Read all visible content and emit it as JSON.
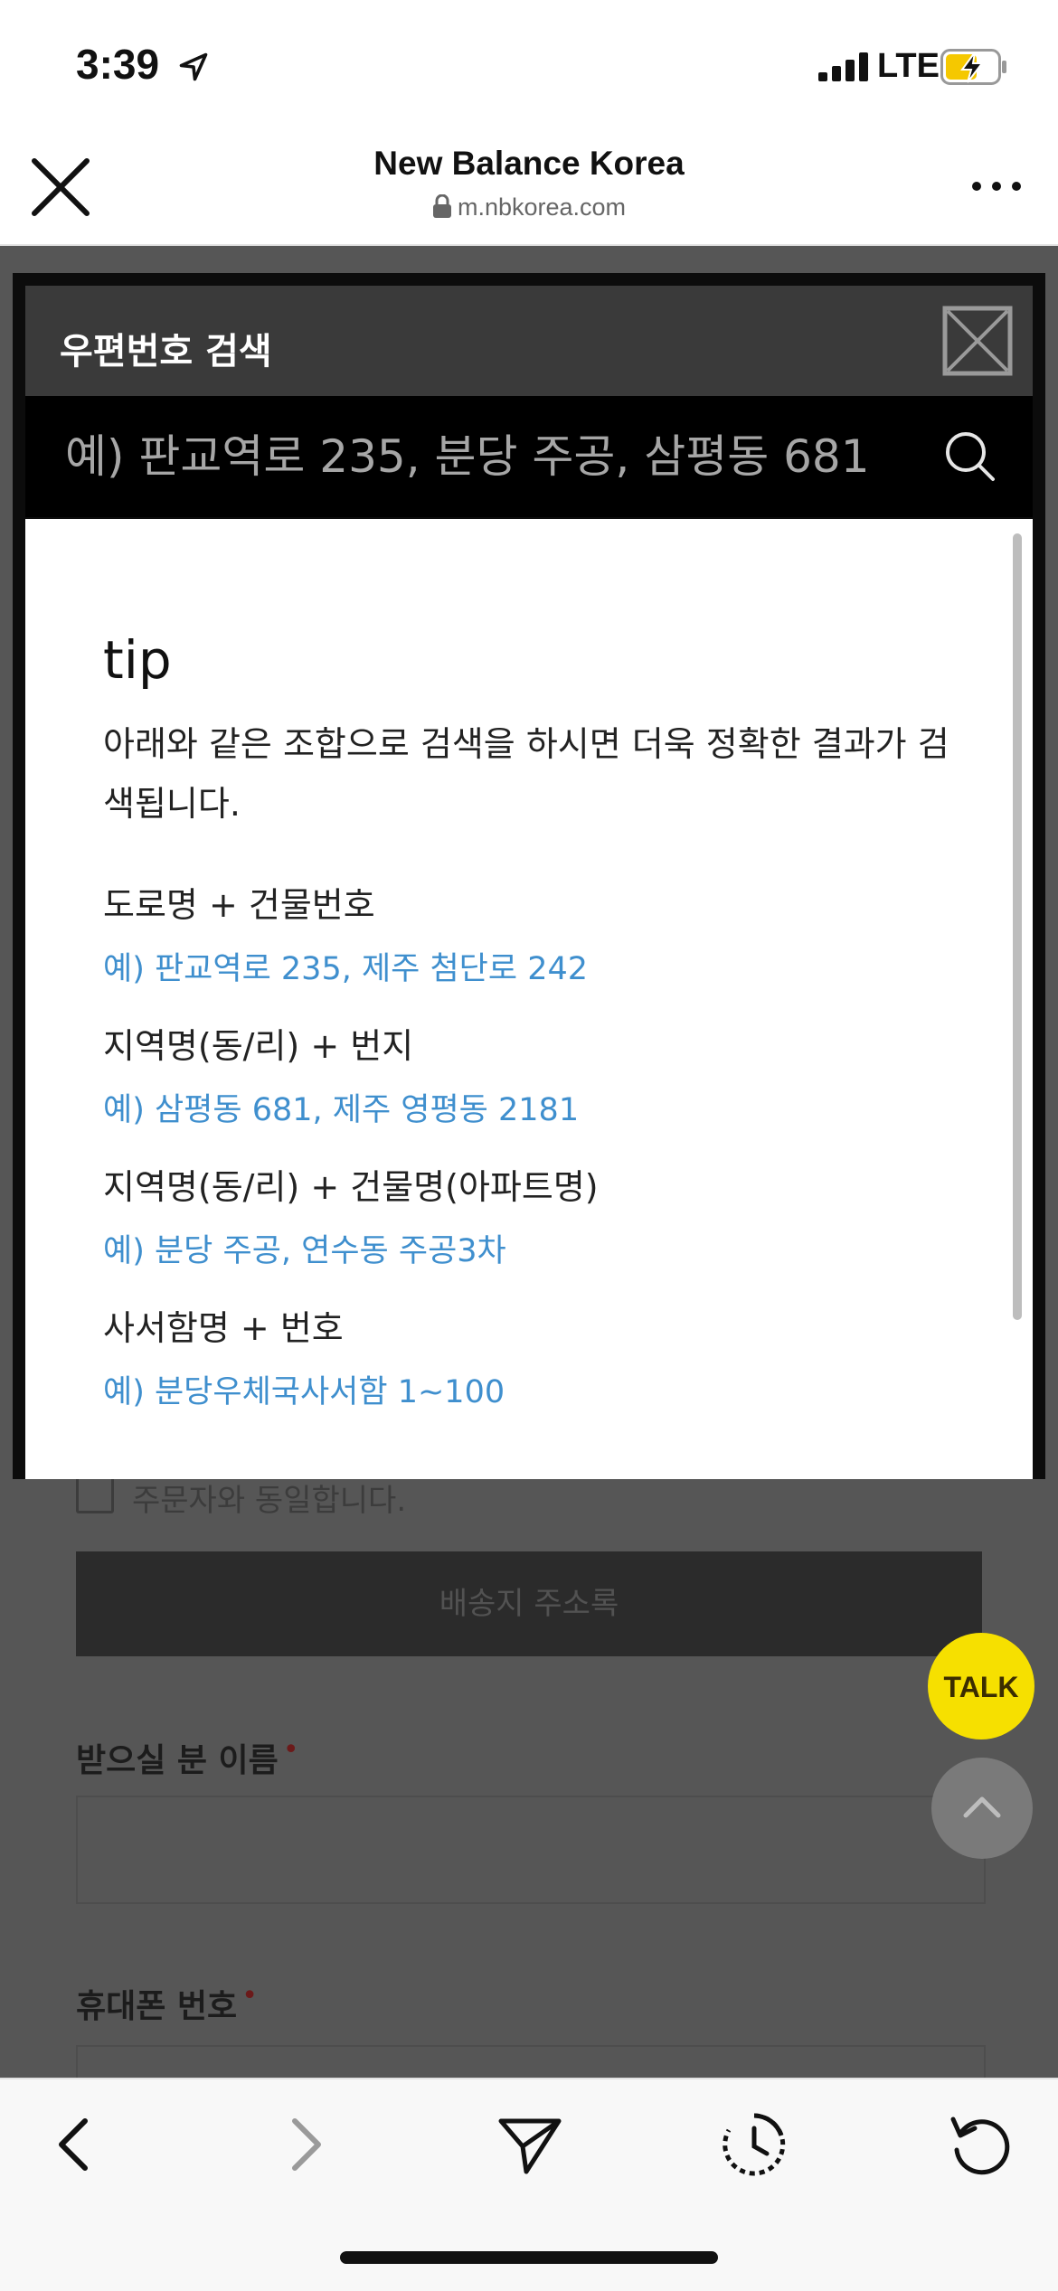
{
  "status_bar": {
    "time": "3:39",
    "network": "LTE"
  },
  "browser": {
    "title": "New Balance Korea",
    "url": "m.nbkorea.com"
  },
  "background_page": {
    "same_as_orderer_label": "주문자와 동일합니다.",
    "address_book_button": "배송지 주소록",
    "recipient_name_label": "받으실 분 이름",
    "phone_label": "휴대폰 번호",
    "required_mark": "•",
    "talk_button": "TALK"
  },
  "modal": {
    "title": "우편번호 검색",
    "search_placeholder": "예) 판교역로 235, 분당 주공, 삼평동 681",
    "tip_title": "tip",
    "tip_description": "아래와 같은 조합으로 검색을 하시면 더욱 정확한 결과가 검색됩니다.",
    "categories": [
      {
        "label": "도로명 + 건물번호",
        "example": "예) 판교역로 235,  제주 첨단로 242"
      },
      {
        "label": "지역명(동/리) + 번지",
        "example": "예) 삼평동 681,  제주 영평동 2181"
      },
      {
        "label": "지역명(동/리) + 건물명(아파트명)",
        "example": "예) 분당 주공,  연수동 주공3차"
      },
      {
        "label": "사서함명 + 번호",
        "example": "예) 분당우체국사서함 1~100"
      }
    ]
  },
  "colors": {
    "example_text": "#3f8fce",
    "talk_yellow": "#f6e000",
    "modal_header": "#3a3a3a"
  },
  "icons": [
    "location-arrow-icon",
    "signal-icon",
    "battery-charging-icon",
    "close-icon",
    "lock-icon",
    "more-icon",
    "search-icon",
    "back-icon",
    "forward-icon",
    "share-icon",
    "history-icon",
    "reload-icon",
    "chevron-up-icon"
  ]
}
